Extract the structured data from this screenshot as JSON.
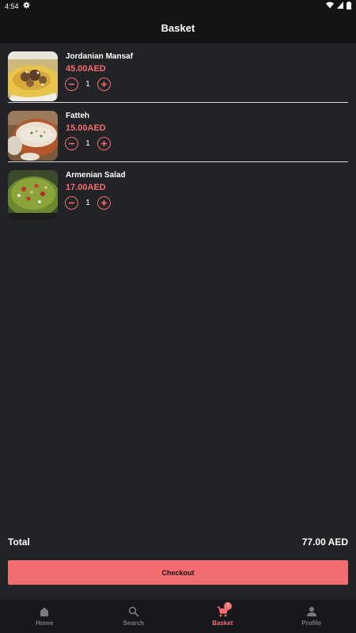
{
  "status_bar": {
    "time": "4:54"
  },
  "app_bar": {
    "title": "Basket"
  },
  "basket": {
    "items": [
      {
        "name": "Jordanian Mansaf",
        "price": "45.00AED",
        "quantity": "1"
      },
      {
        "name": "Fatteh",
        "price": "15.00AED",
        "quantity": "1"
      },
      {
        "name": "Armenian Salad",
        "price": "17.00AED",
        "quantity": "1"
      }
    ]
  },
  "summary": {
    "total_label": "Total",
    "total_value": "77.00 AED"
  },
  "checkout": {
    "label": "Checkout"
  },
  "nav": {
    "items": [
      {
        "label": "Home",
        "icon": "home-icon"
      },
      {
        "label": "Search",
        "icon": "search-icon"
      },
      {
        "label": "Basket",
        "icon": "cart-icon",
        "badge": "3"
      },
      {
        "label": "Profile",
        "icon": "person-icon"
      }
    ],
    "active": "Basket"
  },
  "colors": {
    "accent": "#f36d6f",
    "background": "#222326",
    "bar": "#131416"
  }
}
